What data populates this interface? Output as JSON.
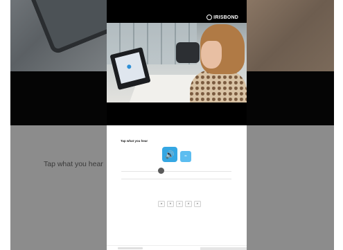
{
  "brand": {
    "name": "IRISBOND"
  },
  "exercise": {
    "prompt": "Tap what you hear",
    "audio_icon": "speaker-icon",
    "slow_audio_icon": "slow-speech-icon",
    "word_bank": [
      "a",
      "b",
      "c",
      "d",
      "e"
    ]
  },
  "background": {
    "ghost_prompt": "Tap what you hear"
  },
  "colors": {
    "accent": "#35a7e3",
    "accent_light": "#5cbdf0",
    "bar": "#000000"
  }
}
